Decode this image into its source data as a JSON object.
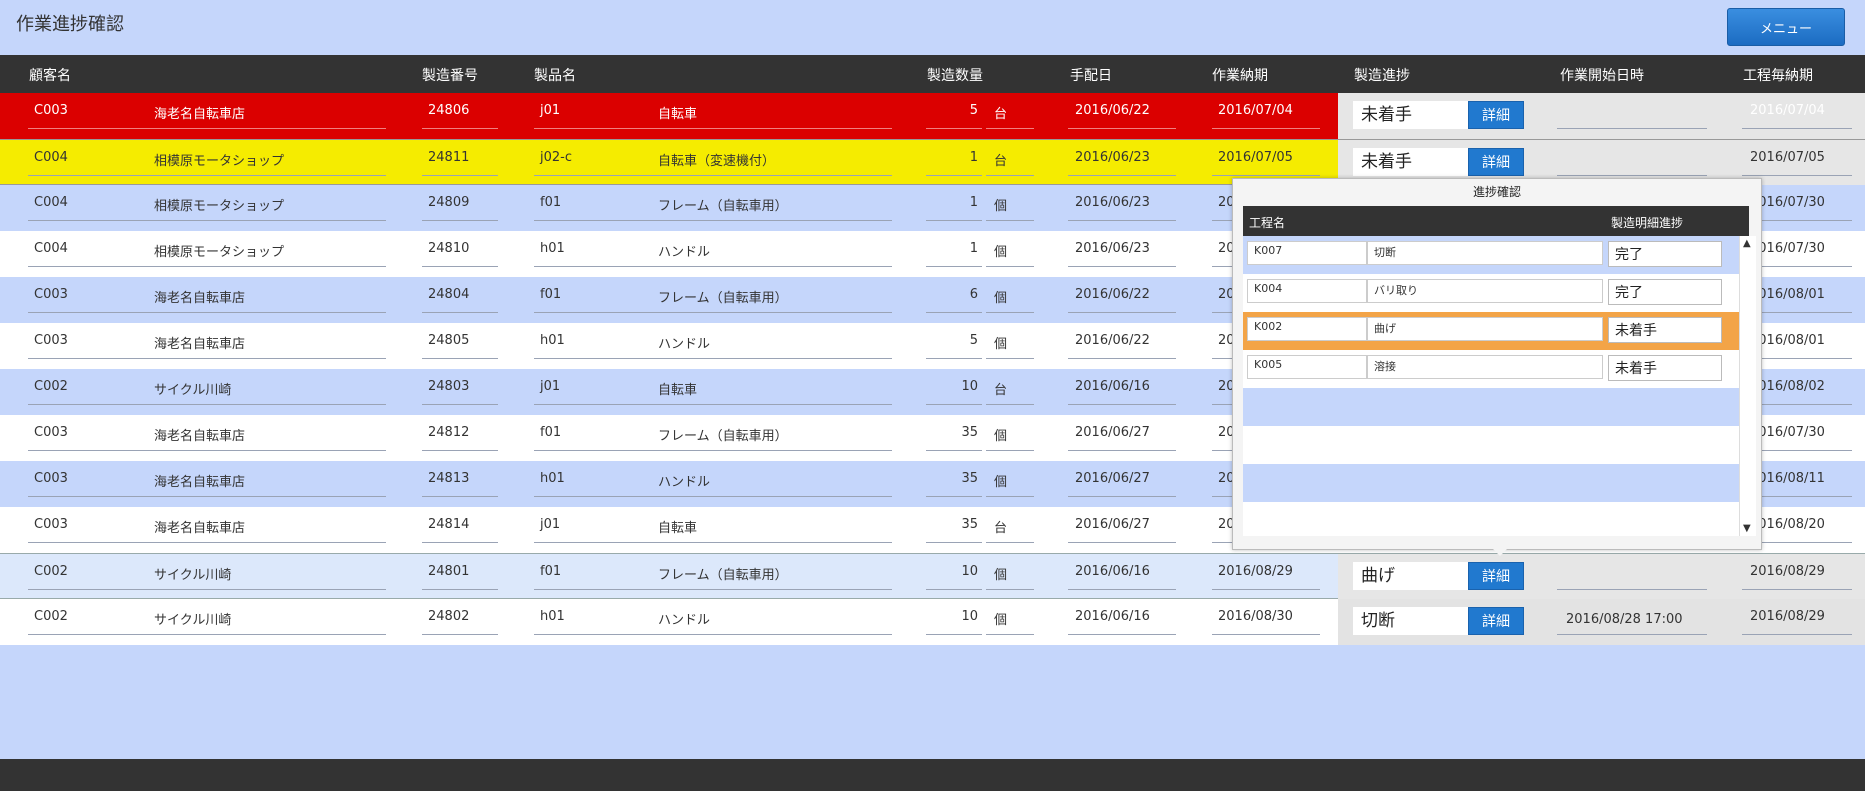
{
  "title": "作業進捗確認",
  "menu_label": "メニュー",
  "columns": {
    "customer": "顧客名",
    "mfg_no": "製造番号",
    "product": "製品名",
    "qty": "製造数量",
    "arrange_date": "手配日",
    "work_deadline": "作業納期",
    "progress": "製造進捗",
    "start_datetime": "作業開始日時",
    "process_deadline": "工程毎納期"
  },
  "detail_label": "詳細",
  "rows": [
    {
      "code": "C003",
      "name": "海老名自転車店",
      "mfg": "24806",
      "pcode": "j01",
      "pname": "自転車",
      "qty": "5",
      "unit": "台",
      "arrange": "2016/06/22",
      "deadline": "2016/07/04",
      "progress": "未着手",
      "start": "",
      "proc_deadline": "2016/07/04"
    },
    {
      "code": "C004",
      "name": "相模原モータショップ",
      "mfg": "24811",
      "pcode": "j02-c",
      "pname": "自転車（変速機付）",
      "qty": "1",
      "unit": "台",
      "arrange": "2016/06/23",
      "deadline": "2016/07/05",
      "progress": "未着手",
      "start": "",
      "proc_deadline": "2016/07/05"
    },
    {
      "code": "C004",
      "name": "相模原モータショップ",
      "mfg": "24809",
      "pcode": "f01",
      "pname": "フレーム（自転車用）",
      "qty": "1",
      "unit": "個",
      "arrange": "2016/06/23",
      "deadline": "20",
      "progress": "",
      "start": "",
      "proc_deadline": "2016/07/30"
    },
    {
      "code": "C004",
      "name": "相模原モータショップ",
      "mfg": "24810",
      "pcode": "h01",
      "pname": "ハンドル",
      "qty": "1",
      "unit": "個",
      "arrange": "2016/06/23",
      "deadline": "20",
      "progress": "",
      "start": "",
      "proc_deadline": "2016/07/30"
    },
    {
      "code": "C003",
      "name": "海老名自転車店",
      "mfg": "24804",
      "pcode": "f01",
      "pname": "フレーム（自転車用）",
      "qty": "6",
      "unit": "個",
      "arrange": "2016/06/22",
      "deadline": "20",
      "progress": "",
      "start": "",
      "proc_deadline": "2016/08/01"
    },
    {
      "code": "C003",
      "name": "海老名自転車店",
      "mfg": "24805",
      "pcode": "h01",
      "pname": "ハンドル",
      "qty": "5",
      "unit": "個",
      "arrange": "2016/06/22",
      "deadline": "20",
      "progress": "",
      "start": "",
      "proc_deadline": "2016/08/01"
    },
    {
      "code": "C002",
      "name": "サイクル川崎",
      "mfg": "24803",
      "pcode": "j01",
      "pname": "自転車",
      "qty": "10",
      "unit": "台",
      "arrange": "2016/06/16",
      "deadline": "20",
      "progress": "",
      "start": "",
      "proc_deadline": "2016/08/02"
    },
    {
      "code": "C003",
      "name": "海老名自転車店",
      "mfg": "24812",
      "pcode": "f01",
      "pname": "フレーム（自転車用）",
      "qty": "35",
      "unit": "個",
      "arrange": "2016/06/27",
      "deadline": "20",
      "progress": "",
      "start": "",
      "proc_deadline": "2016/07/30"
    },
    {
      "code": "C003",
      "name": "海老名自転車店",
      "mfg": "24813",
      "pcode": "h01",
      "pname": "ハンドル",
      "qty": "35",
      "unit": "個",
      "arrange": "2016/06/27",
      "deadline": "20",
      "progress": "",
      "start": "",
      "proc_deadline": "2016/08/11"
    },
    {
      "code": "C003",
      "name": "海老名自転車店",
      "mfg": "24814",
      "pcode": "j01",
      "pname": "自転車",
      "qty": "35",
      "unit": "台",
      "arrange": "2016/06/27",
      "deadline": "20",
      "progress": "",
      "start": "",
      "proc_deadline": "2016/08/20"
    },
    {
      "code": "C002",
      "name": "サイクル川崎",
      "mfg": "24801",
      "pcode": "f01",
      "pname": "フレーム（自転車用）",
      "qty": "10",
      "unit": "個",
      "arrange": "2016/06/16",
      "deadline": "2016/08/29",
      "progress": "曲げ",
      "start": "",
      "proc_deadline": "2016/08/29"
    },
    {
      "code": "C002",
      "name": "サイクル川崎",
      "mfg": "24802",
      "pcode": "h01",
      "pname": "ハンドル",
      "qty": "10",
      "unit": "個",
      "arrange": "2016/06/16",
      "deadline": "2016/08/30",
      "progress": "切断",
      "start": "2016/08/28 17:00",
      "proc_deadline": "2016/08/29"
    }
  ],
  "popup": {
    "title": "進捗確認",
    "col_process": "工程名",
    "col_status": "製造明細進捗",
    "items": [
      {
        "code": "K007",
        "name": "切断",
        "status": "完了"
      },
      {
        "code": "K004",
        "name": "バリ取り",
        "status": "完了"
      },
      {
        "code": "K002",
        "name": "曲げ",
        "status": "未着手"
      },
      {
        "code": "K005",
        "name": "溶接",
        "status": "未着手"
      }
    ],
    "scroll_up": "▲",
    "scroll_down": "▼"
  },
  "colors": {
    "row_red": "#db0000",
    "row_yellow": "#f5ec00",
    "row_blue": "#c5d6fb",
    "accent_button": "#2179cf",
    "popup_highlight": "#f3a447"
  }
}
